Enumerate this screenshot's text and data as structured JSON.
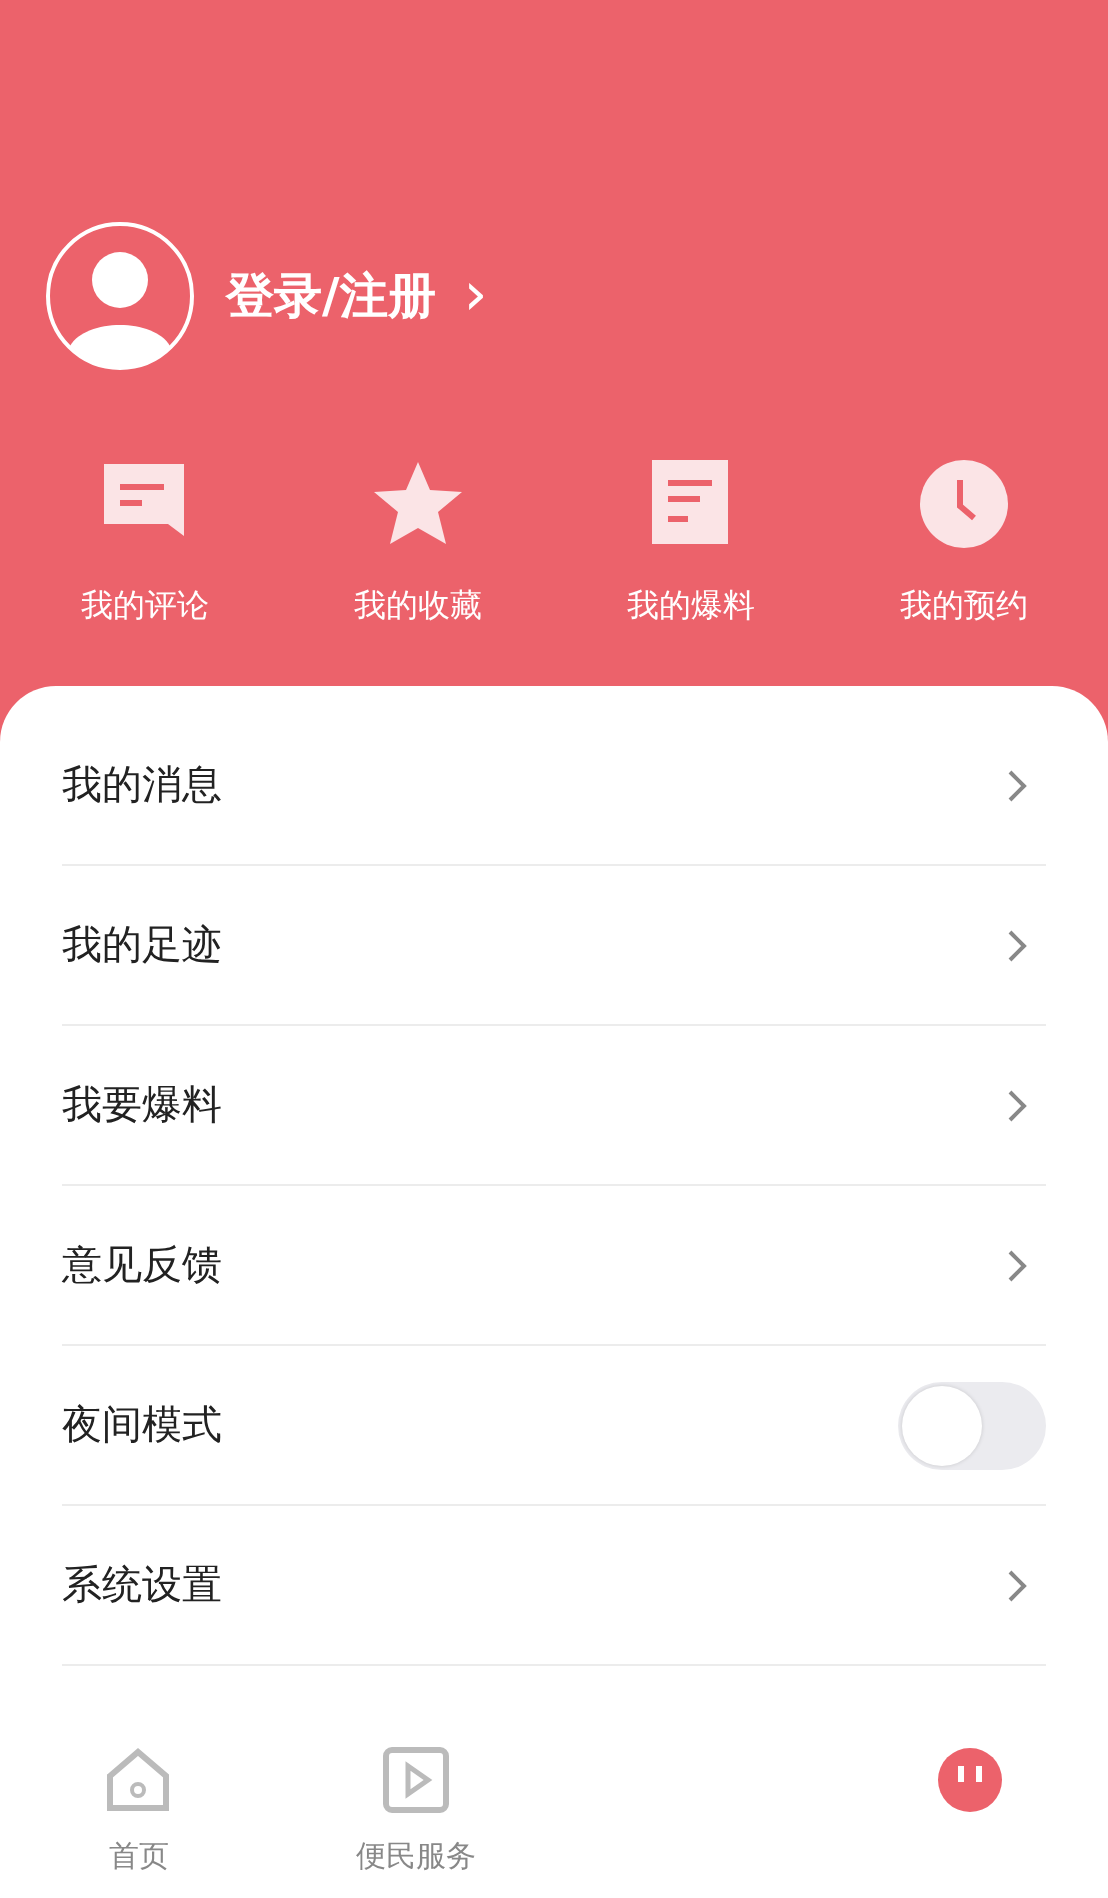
{
  "profile": {
    "login_label": "登录/注册",
    "chevron": "›"
  },
  "shortcuts": [
    {
      "kind": "comment",
      "label": "我的评论"
    },
    {
      "kind": "star",
      "label": "我的收藏"
    },
    {
      "kind": "doc",
      "label": "我的爆料"
    },
    {
      "kind": "clock",
      "label": "我的预约"
    }
  ],
  "menu": [
    {
      "kind": "link",
      "label": "我的消息"
    },
    {
      "kind": "link",
      "label": "我的足迹"
    },
    {
      "kind": "link",
      "label": "我要爆料"
    },
    {
      "kind": "link",
      "label": "意见反馈"
    },
    {
      "kind": "toggle",
      "label": "夜间模式",
      "on": false
    },
    {
      "kind": "link",
      "label": "系统设置"
    }
  ],
  "tab_bar": [
    {
      "kind": "home",
      "label": "首页",
      "selected": false
    },
    {
      "kind": "play",
      "label": "便民服务",
      "selected": false
    },
    {
      "kind": "empty"
    },
    {
      "kind": "me",
      "selected": true
    }
  ]
}
